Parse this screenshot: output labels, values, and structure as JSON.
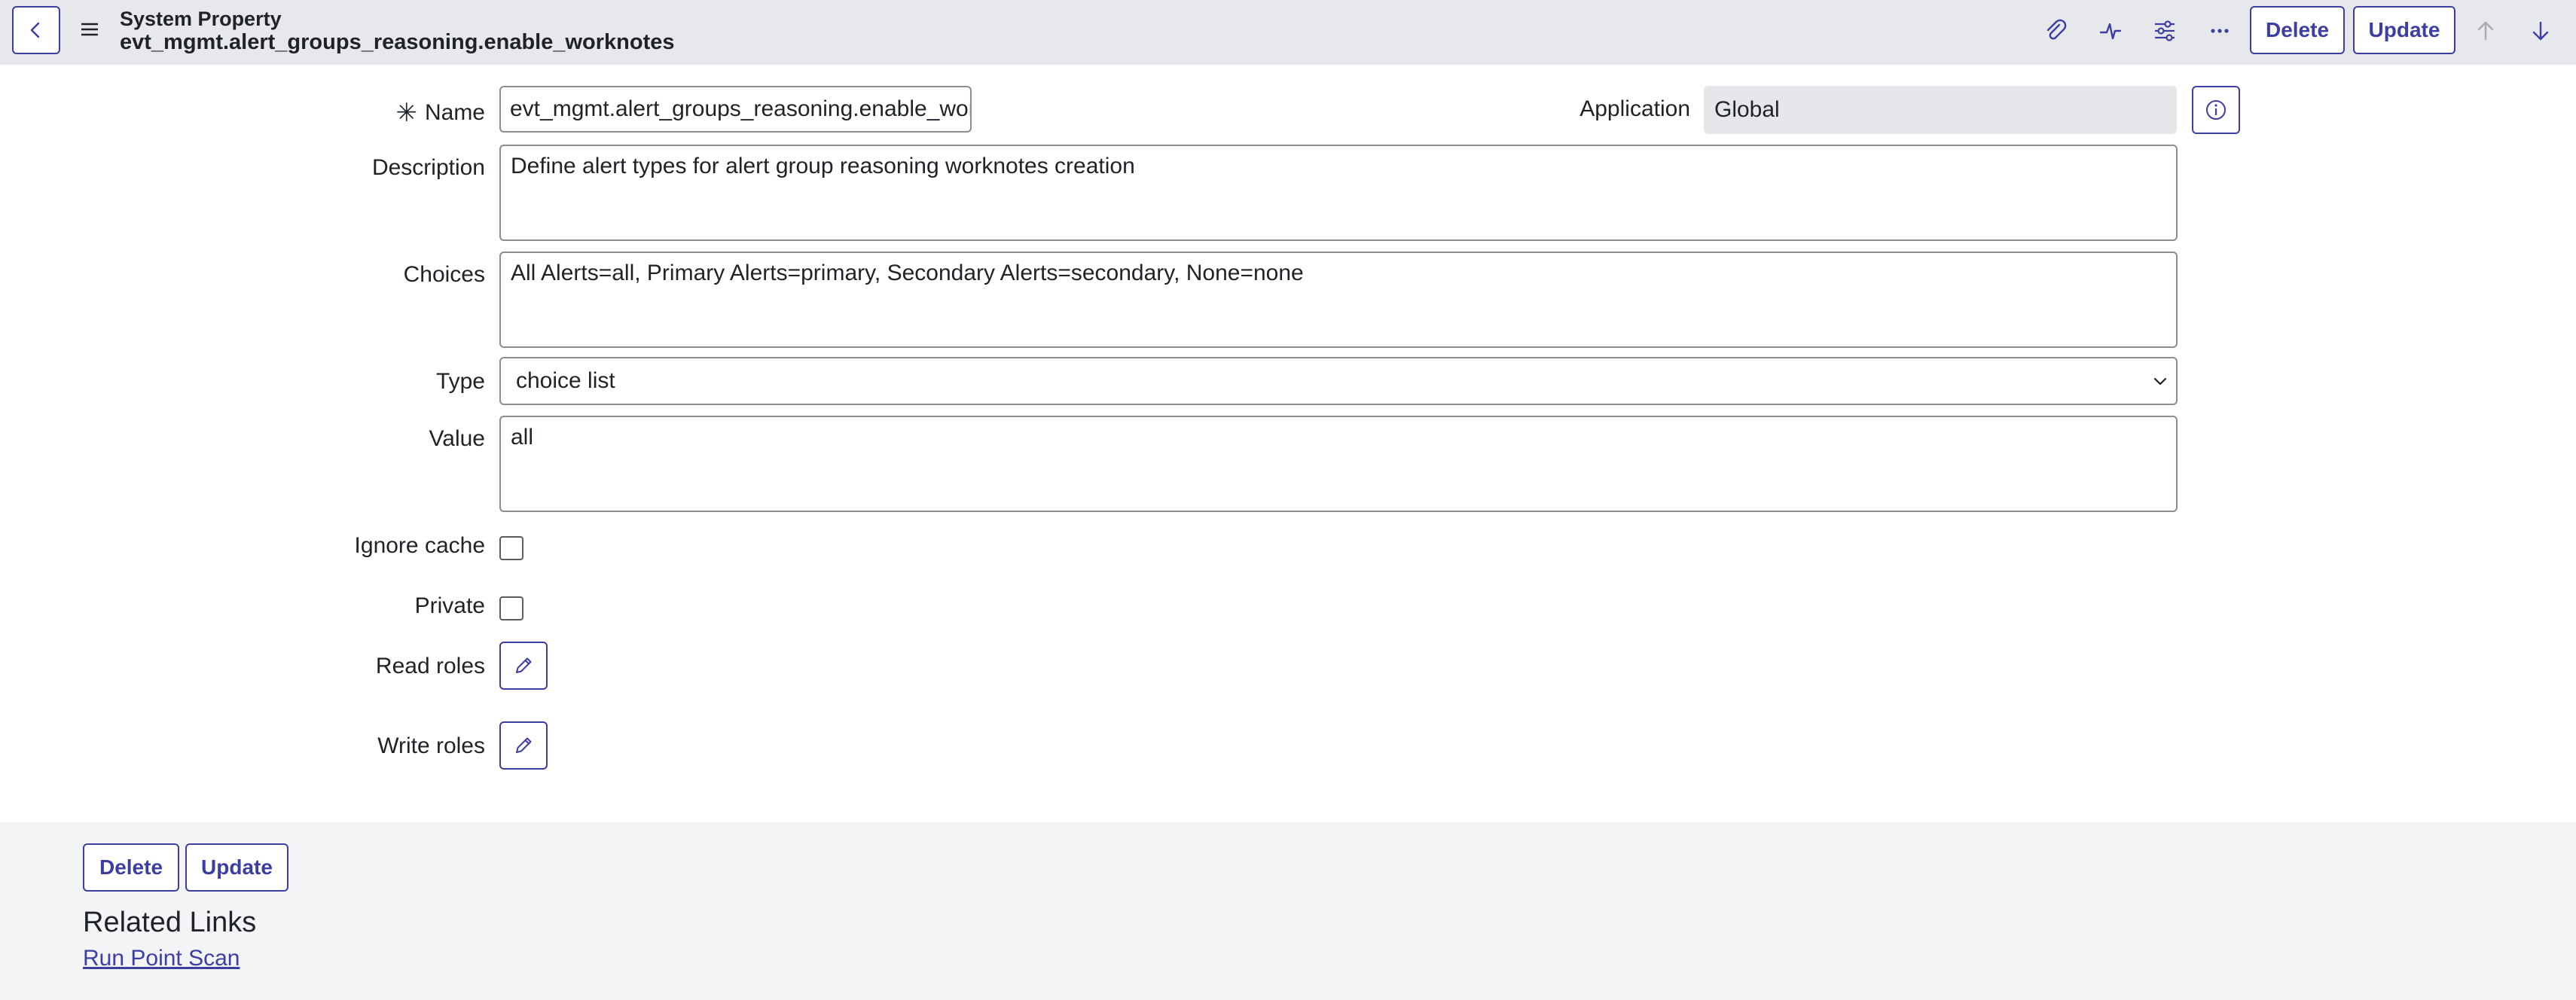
{
  "header": {
    "record_type": "System Property",
    "record_name": "evt_mgmt.alert_groups_reasoning.enable_worknotes",
    "icons": [
      "back-icon",
      "menu-icon",
      "paperclip-icon",
      "activity-icon",
      "sliders-icon",
      "more-icon",
      "arrow-up-icon",
      "arrow-down-icon"
    ],
    "delete_label": "Delete",
    "update_label": "Update"
  },
  "form": {
    "name_label": "Name",
    "name_value": "evt_mgmt.alert_groups_reasoning.enable_workno",
    "application_label": "Application",
    "application_value": "Global",
    "description_label": "Description",
    "description_value": "Define alert types for alert group reasoning worknotes creation",
    "choices_label": "Choices",
    "choices_value": "All Alerts=all, Primary Alerts=primary, Secondary Alerts=secondary, None=none",
    "type_label": "Type",
    "type_value": "choice list",
    "value_label": "Value",
    "value_value": "all",
    "ignore_cache_label": "Ignore cache",
    "ignore_cache_checked": false,
    "private_label": "Private",
    "private_checked": false,
    "read_roles_label": "Read roles",
    "write_roles_label": "Write roles"
  },
  "footer": {
    "delete_label": "Delete",
    "update_label": "Update",
    "related_links_title": "Related Links",
    "links": [
      "Run Point Scan"
    ]
  },
  "colors": {
    "accent": "#3c3fa1",
    "header_bg": "#e7e8ec",
    "footer_bg": "#f3f4f6",
    "readonly_bg": "#e6e7ea"
  }
}
